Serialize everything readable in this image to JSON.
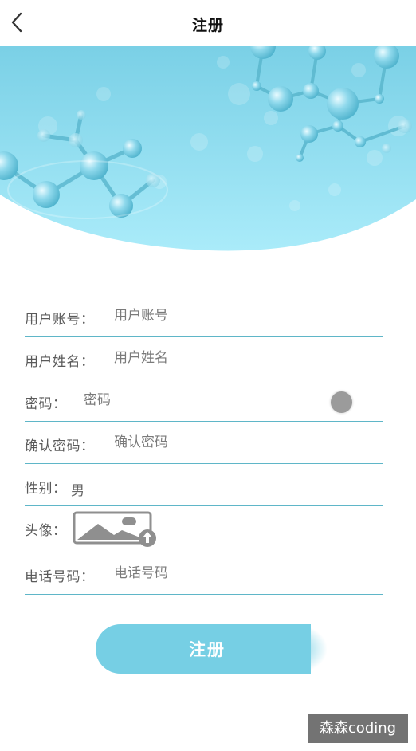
{
  "header": {
    "title": "注册"
  },
  "form": {
    "account": {
      "label": "用户账号：",
      "placeholder": "用户账号"
    },
    "name": {
      "label": "用户姓名：",
      "placeholder": "用户姓名"
    },
    "password": {
      "label": "密码：",
      "placeholder": "密码"
    },
    "confirm": {
      "label": "确认密码：",
      "placeholder": "确认密码"
    },
    "gender": {
      "label": "性别：",
      "value": "男"
    },
    "avatar": {
      "label": "头像："
    },
    "phone": {
      "label": "电话号码：",
      "placeholder": "电话号码"
    }
  },
  "submit": {
    "label": "注册"
  },
  "watermark": {
    "text": "森森coding"
  },
  "colors": {
    "accent": "#76cfe4",
    "divider": "#5fb6c8",
    "hero_top": "#7fd3e8",
    "hero_bottom": "#a9eaf9"
  },
  "icons": {
    "back": "chevron-left-icon",
    "upload": "image-upload-icon",
    "password_toggle": "toggle-dot-icon"
  }
}
